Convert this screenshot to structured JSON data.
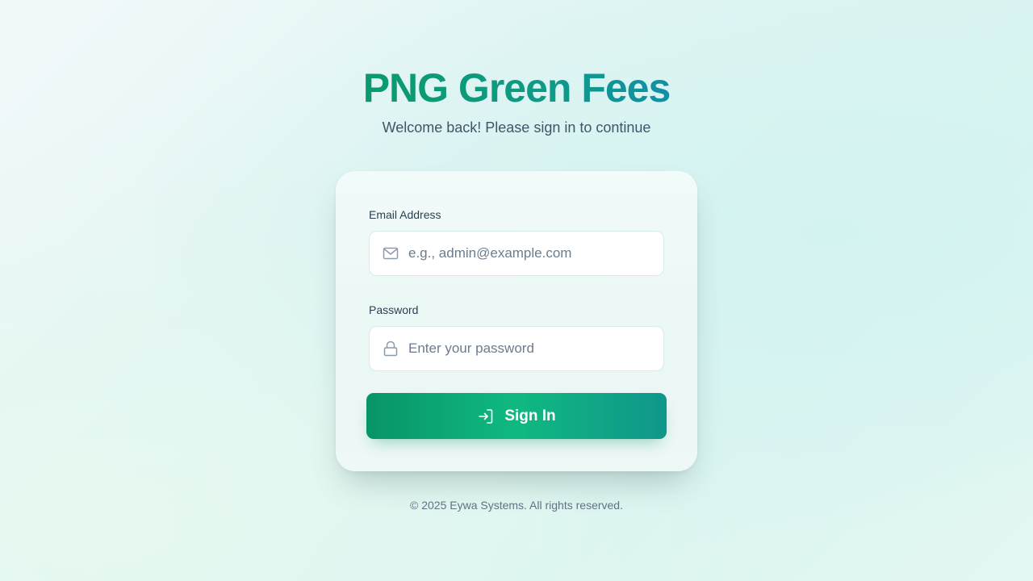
{
  "app": {
    "title": "PNG Green Fees",
    "subtitle": "Welcome back! Please sign in to continue"
  },
  "form": {
    "email": {
      "label": "Email Address",
      "placeholder": "e.g., admin@example.com",
      "value": "",
      "icon": "mail-icon"
    },
    "password": {
      "label": "Password",
      "placeholder": "Enter your password",
      "value": "",
      "icon": "lock-icon"
    },
    "submit": {
      "label": "Sign In",
      "icon": "sign-in-icon"
    }
  },
  "footer": {
    "text": "© 2025 Eywa Systems. All rights reserved."
  },
  "colors": {
    "brand_green": "#0a9a6e",
    "brand_teal": "#1190a6",
    "button_gradient_start": "#079467",
    "button_gradient_mid": "#10b981",
    "button_gradient_end": "#0f968b"
  }
}
